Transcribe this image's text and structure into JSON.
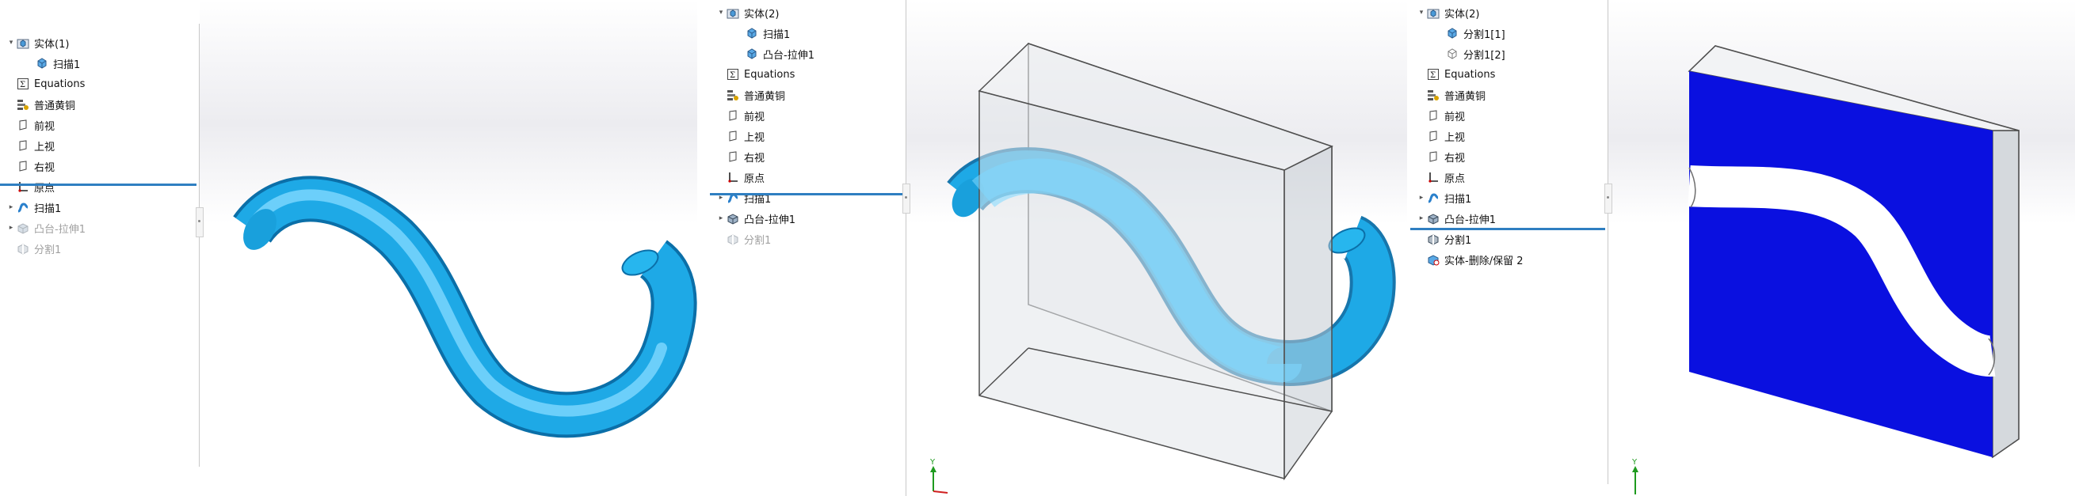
{
  "panels": [
    {
      "tree": [
        {
          "label": "实体(1)",
          "icon": "solid-bodies-folder-icon",
          "arrow": "▾",
          "level": 0,
          "dim": false
        },
        {
          "label": "扫描1",
          "icon": "solid-body-icon",
          "arrow": "",
          "level": 1,
          "dim": false
        },
        {
          "label": "Equations",
          "icon": "equations-icon",
          "arrow": "",
          "level": 0,
          "dim": false
        },
        {
          "label": "普通黄铜",
          "icon": "material-icon",
          "arrow": "",
          "level": 0,
          "dim": false
        },
        {
          "label": "前视",
          "icon": "plane-icon",
          "arrow": "",
          "level": 0,
          "dim": false
        },
        {
          "label": "上视",
          "icon": "plane-icon",
          "arrow": "",
          "level": 0,
          "dim": false
        },
        {
          "label": "右视",
          "icon": "plane-icon",
          "arrow": "",
          "level": 0,
          "dim": false
        },
        {
          "label": "原点",
          "icon": "origin-icon",
          "arrow": "",
          "level": 0,
          "dim": false
        },
        {
          "label": "扫描1",
          "icon": "sweep-feature-icon",
          "arrow": "▸",
          "level": 0,
          "dim": false
        },
        {
          "label": "凸台-拉伸1",
          "icon": "boss-extrude-icon",
          "arrow": "▸",
          "level": 0,
          "dim": true
        },
        {
          "label": "分割1",
          "icon": "split-feature-icon",
          "arrow": "",
          "level": 0,
          "dim": true
        }
      ]
    },
    {
      "tree": [
        {
          "label": "实体(2)",
          "icon": "solid-bodies-folder-icon",
          "arrow": "▾",
          "level": 0,
          "dim": false
        },
        {
          "label": "扫描1",
          "icon": "solid-body-icon",
          "arrow": "",
          "level": 1,
          "dim": false
        },
        {
          "label": "凸台-拉伸1",
          "icon": "solid-body-icon",
          "arrow": "",
          "level": 1,
          "dim": false
        },
        {
          "label": "Equations",
          "icon": "equations-icon",
          "arrow": "",
          "level": 0,
          "dim": false
        },
        {
          "label": "普通黄铜",
          "icon": "material-icon",
          "arrow": "",
          "level": 0,
          "dim": false
        },
        {
          "label": "前视",
          "icon": "plane-icon",
          "arrow": "",
          "level": 0,
          "dim": false
        },
        {
          "label": "上视",
          "icon": "plane-icon",
          "arrow": "",
          "level": 0,
          "dim": false
        },
        {
          "label": "右视",
          "icon": "plane-icon",
          "arrow": "",
          "level": 0,
          "dim": false
        },
        {
          "label": "原点",
          "icon": "origin-icon",
          "arrow": "",
          "level": 0,
          "dim": false
        },
        {
          "label": "扫描1",
          "icon": "sweep-feature-icon",
          "arrow": "▸",
          "level": 0,
          "dim": false
        },
        {
          "label": "凸台-拉伸1",
          "icon": "boss-extrude-icon",
          "arrow": "▸",
          "level": 0,
          "dim": false
        },
        {
          "label": "分割1",
          "icon": "split-feature-icon",
          "arrow": "",
          "level": 0,
          "dim": true
        }
      ]
    },
    {
      "tree": [
        {
          "label": "实体(2)",
          "icon": "solid-bodies-folder-icon",
          "arrow": "▾",
          "level": 0,
          "dim": false
        },
        {
          "label": "分割1[1]",
          "icon": "solid-body-icon",
          "arrow": "",
          "level": 1,
          "dim": false
        },
        {
          "label": "分割1[2]",
          "icon": "hidden-body-icon",
          "arrow": "",
          "level": 1,
          "dim": false
        },
        {
          "label": "Equations",
          "icon": "equations-icon",
          "arrow": "",
          "level": 0,
          "dim": false
        },
        {
          "label": "普通黄铜",
          "icon": "material-icon",
          "arrow": "",
          "level": 0,
          "dim": false
        },
        {
          "label": "前视",
          "icon": "plane-icon",
          "arrow": "",
          "level": 0,
          "dim": false
        },
        {
          "label": "上视",
          "icon": "plane-icon",
          "arrow": "",
          "level": 0,
          "dim": false
        },
        {
          "label": "右视",
          "icon": "plane-icon",
          "arrow": "",
          "level": 0,
          "dim": false
        },
        {
          "label": "原点",
          "icon": "origin-icon",
          "arrow": "",
          "level": 0,
          "dim": false
        },
        {
          "label": "扫描1",
          "icon": "sweep-feature-icon",
          "arrow": "▸",
          "level": 0,
          "dim": false
        },
        {
          "label": "凸台-拉伸1",
          "icon": "boss-extrude-icon",
          "arrow": "▸",
          "level": 0,
          "dim": false
        },
        {
          "label": "分割1",
          "icon": "split-feature-icon",
          "arrow": "",
          "level": 0,
          "dim": false
        },
        {
          "label": "实体-删除/保留 2",
          "icon": "delete-body-icon",
          "arrow": "",
          "level": 0,
          "dim": false
        }
      ]
    }
  ],
  "triad": {
    "y_label": "Y"
  },
  "colors": {
    "tube": "#1ea9e6",
    "tube_light": "#8fe3ff",
    "face": "#0a10e0",
    "rollback": "#2f7fc1"
  }
}
